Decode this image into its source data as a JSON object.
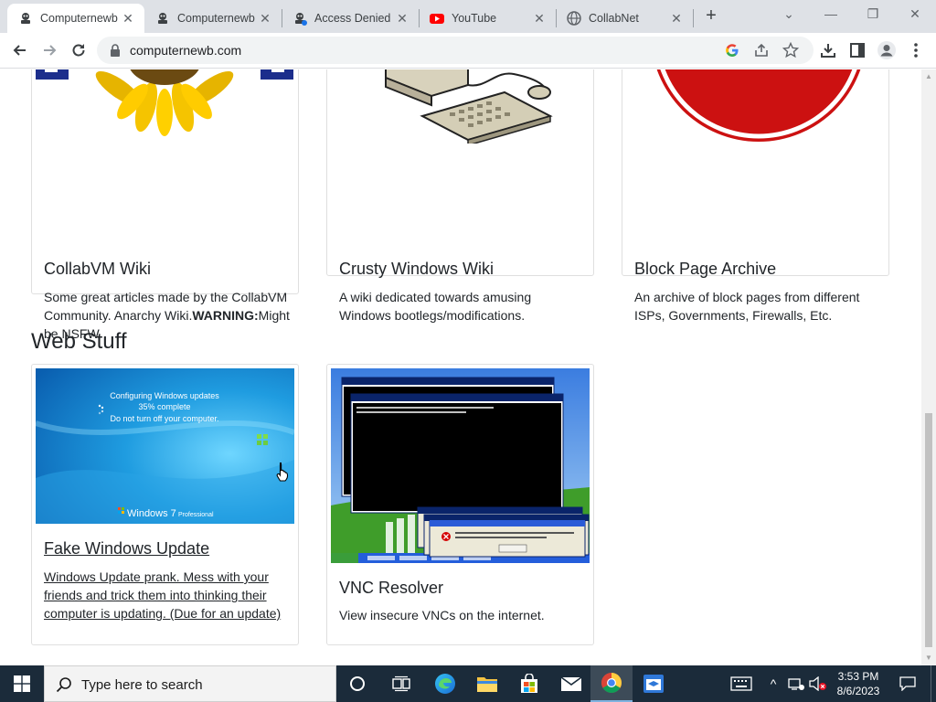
{
  "browser": {
    "tabs": [
      {
        "title": "Computernewb",
        "active": true
      },
      {
        "title": "Computernewb",
        "active": false
      },
      {
        "title": "Access Denied",
        "active": false
      },
      {
        "title": "YouTube",
        "active": false
      },
      {
        "title": "CollabNet",
        "active": false
      }
    ],
    "url": "computernewb.com"
  },
  "cards_top": [
    {
      "title": "CollabVM Wiki",
      "desc": "Some great articles made by the CollabVM Community. Anarchy Wiki.",
      "warning": "WARNING:",
      "warning_tail": "Might be NSFW"
    },
    {
      "title": "Crusty Windows Wiki",
      "desc": "A wiki dedicated towards amusing Windows bootlegs/modifications."
    },
    {
      "title": "Block Page Archive",
      "desc": "An archive of block pages from different ISPs, Governments, Firewalls, Etc."
    }
  ],
  "section": {
    "title": "Web Stuff"
  },
  "cards_web": [
    {
      "title": "Fake Windows Update",
      "desc": "Windows Update prank. Mess with your friends and trick them into thinking their computer is updating. (Due for an update)",
      "screen": {
        "line1": "Configuring Windows updates",
        "line2": "35% complete",
        "line3": "Do not turn off your computer.",
        "brand": "Windows 7",
        "edition": "Professional"
      }
    },
    {
      "title": "VNC Resolver",
      "desc": "View insecure VNCs on the internet."
    }
  ],
  "taskbar": {
    "search_placeholder": "Type here to search",
    "time": "3:53 PM",
    "date": "8/6/2023"
  },
  "colors": {
    "tabstrip": "#dee1e6",
    "taskbar": "#1b2b3a",
    "chrome_red": "#db4437",
    "youtube_red": "#ff0000"
  }
}
